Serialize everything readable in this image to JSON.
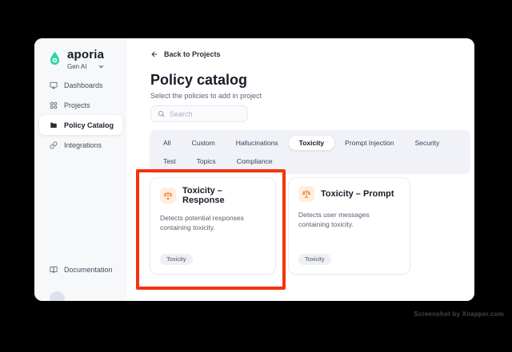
{
  "colors": {
    "brand_teal": "#2ed3a6",
    "icon_orange": "#f0802f",
    "icon_orange_bg": "#fdeedd",
    "highlight_red": "#f6330e",
    "sidebar_bg": "#f7f8fa",
    "tabs_bg": "#f1f2f7"
  },
  "icons": {
    "logo": "aporia-droplet",
    "dashboards": "monitor-icon",
    "projects": "grid-icon",
    "policy_catalog": "folder-icon",
    "integrations": "link-icon",
    "documentation": "book-open-icon",
    "search": "magnifier-icon",
    "back": "arrow-left-icon",
    "workspace": "chevron-down-icon",
    "policy": "scales-icon"
  },
  "sidebar": {
    "brand": "aporia",
    "workspace": "Gen AI",
    "items": [
      {
        "label": "Dashboards",
        "active": false
      },
      {
        "label": "Projects",
        "active": false
      },
      {
        "label": "Policy Catalog",
        "active": true
      },
      {
        "label": "Integrations",
        "active": false
      }
    ],
    "footer": {
      "label": "Documentation"
    }
  },
  "main": {
    "back_link": "Back to Projects",
    "title": "Policy catalog",
    "subtitle": "Select the policies to add in project",
    "search_placeholder": "Search",
    "tabs": [
      {
        "label": "All",
        "active": false
      },
      {
        "label": "Custom",
        "active": false
      },
      {
        "label": "Hallucinations",
        "active": false
      },
      {
        "label": "Toxicity",
        "active": true
      },
      {
        "label": "Prompt Injection",
        "active": false
      },
      {
        "label": "Security",
        "active": false
      },
      {
        "label": "Test",
        "active": false
      },
      {
        "label": "Topics",
        "active": false
      },
      {
        "label": "Compliance",
        "active": false
      }
    ],
    "cards": [
      {
        "title": "Toxicity – Response",
        "description": "Detects potential responses containing toxicity.",
        "tag": "Toxicity",
        "highlighted": true
      },
      {
        "title": "Toxicity – Prompt",
        "description": "Detects user messages containing toxicity.",
        "tag": "Toxicity",
        "highlighted": false
      }
    ]
  },
  "watermark": "Screenshot by Xnapper.com"
}
